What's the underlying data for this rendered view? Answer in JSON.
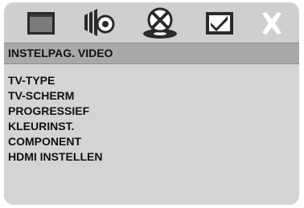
{
  "icon_bar": {
    "icons": [
      {
        "name": "general-setup-icon",
        "selected": false
      },
      {
        "name": "audio-setup-icon",
        "selected": false
      },
      {
        "name": "video-setup-icon",
        "selected": true
      },
      {
        "name": "preference-setup-icon",
        "selected": false
      },
      {
        "name": "close-icon",
        "selected": false
      }
    ]
  },
  "header": {
    "title": "INSTELPAG. VIDEO"
  },
  "menu": {
    "items": [
      {
        "label": "TV-TYPE"
      },
      {
        "label": "TV-SCHERM"
      },
      {
        "label": "PROGRESSIEF"
      },
      {
        "label": "KLEURINST."
      },
      {
        "label": "COMPONENT"
      },
      {
        "label": "HDMI INSTELLEN"
      }
    ]
  },
  "colors": {
    "panel": "#d4d4d4",
    "header": "#a9a9a9",
    "icon_dark": "#2a2a2a",
    "icon_light": "#ffffff",
    "text": "#111111"
  }
}
